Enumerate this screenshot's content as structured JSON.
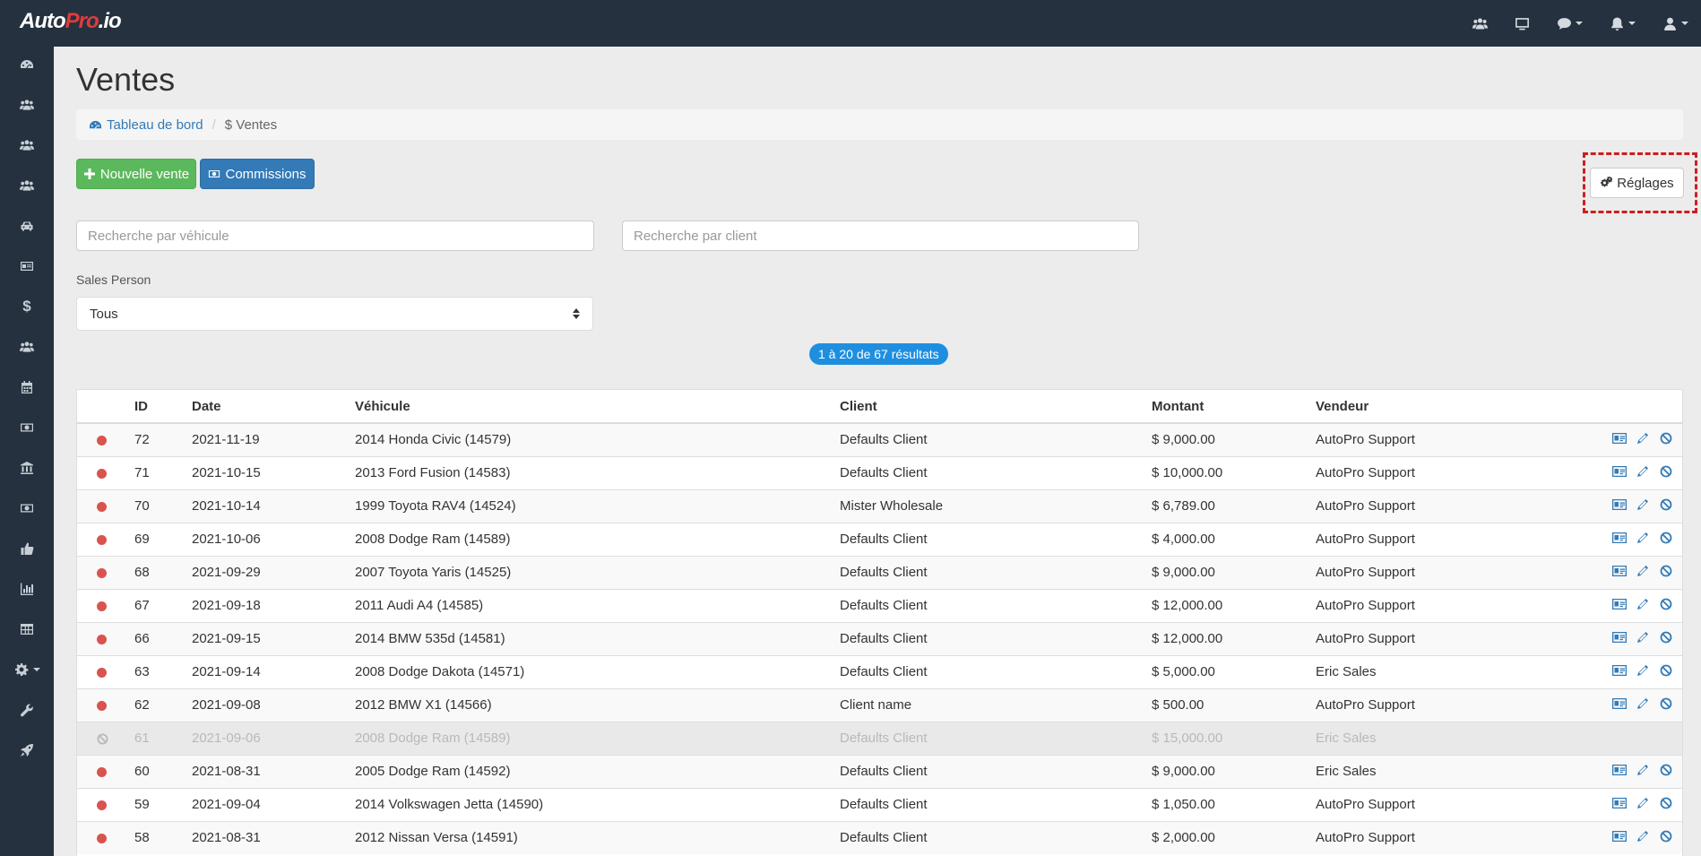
{
  "app": {
    "logo_main": "Auto",
    "logo_accent": "Pro",
    "logo_suffix": ".io"
  },
  "colors": {
    "navbar": "#26313f",
    "accent_red": "#e03b3b",
    "success": "#5cb85c",
    "primary": "#337ab7",
    "badge": "#1e8fe0",
    "status_dot": "#d9534f"
  },
  "topbar": {
    "icons": [
      "users-icon",
      "monitor-icon",
      "chat-icon",
      "bell-icon",
      "user-icon"
    ]
  },
  "sidebar": {
    "items": [
      "dashboard-icon",
      "users-icon",
      "users-icon",
      "users-icon",
      "car-icon",
      "id-card-icon",
      "dollar-icon",
      "users-icon",
      "calendar-icon",
      "money-icon",
      "bank-icon",
      "money-icon",
      "thumbs-up-icon",
      "bar-chart-icon",
      "table-icon",
      "gear-icon",
      "wrench-icon",
      "rocket-icon"
    ],
    "dollar_glyph": "$"
  },
  "page": {
    "title": "Ventes"
  },
  "breadcrumb": {
    "home": "Tableau de bord",
    "current_symbol": "$",
    "current": "Ventes"
  },
  "toolbar": {
    "new_sale": "Nouvelle vente",
    "commissions": "Commissions",
    "settings": "Réglages"
  },
  "filters": {
    "vehicle_placeholder": "Recherche par véhicule",
    "client_placeholder": "Recherche par client",
    "sales_person_label": "Sales Person",
    "sales_person_value": "Tous"
  },
  "results": {
    "badge": "1 à 20 de 67 résultats"
  },
  "table": {
    "headers": {
      "status": "",
      "id": "ID",
      "date": "Date",
      "vehicle": "Véhicule",
      "client": "Client",
      "amount": "Montant",
      "seller": "Vendeur",
      "actions": ""
    },
    "rows": [
      {
        "status": "active",
        "id": "72",
        "date": "2021-11-19",
        "vehicle": "2014 Honda Civic (14579)",
        "client": "Defaults Client",
        "amount": "$ 9,000.00",
        "seller": "AutoPro Support"
      },
      {
        "status": "active",
        "id": "71",
        "date": "2021-10-15",
        "vehicle": "2013 Ford Fusion (14583)",
        "client": "Defaults Client",
        "amount": "$ 10,000.00",
        "seller": "AutoPro Support"
      },
      {
        "status": "active",
        "id": "70",
        "date": "2021-10-14",
        "vehicle": "1999 Toyota RAV4 (14524)",
        "client": "Mister Wholesale",
        "amount": "$ 6,789.00",
        "seller": "AutoPro Support"
      },
      {
        "status": "active",
        "id": "69",
        "date": "2021-10-06",
        "vehicle": "2008 Dodge Ram (14589)",
        "client": "Defaults Client",
        "amount": "$ 4,000.00",
        "seller": "AutoPro Support"
      },
      {
        "status": "active",
        "id": "68",
        "date": "2021-09-29",
        "vehicle": "2007 Toyota Yaris (14525)",
        "client": "Defaults Client",
        "amount": "$ 9,000.00",
        "seller": "AutoPro Support"
      },
      {
        "status": "active",
        "id": "67",
        "date": "2021-09-18",
        "vehicle": "2011 Audi A4 (14585)",
        "client": "Defaults Client",
        "amount": "$ 12,000.00",
        "seller": "AutoPro Support"
      },
      {
        "status": "active",
        "id": "66",
        "date": "2021-09-15",
        "vehicle": "2014 BMW 535d (14581)",
        "client": "Defaults Client",
        "amount": "$ 12,000.00",
        "seller": "AutoPro Support"
      },
      {
        "status": "active",
        "id": "63",
        "date": "2021-09-14",
        "vehicle": "2008 Dodge Dakota (14571)",
        "client": "Defaults Client",
        "amount": "$ 5,000.00",
        "seller": "Eric Sales"
      },
      {
        "status": "active",
        "id": "62",
        "date": "2021-09-08",
        "vehicle": "2012 BMW X1 (14566)",
        "client": "Client name",
        "amount": "$ 500.00",
        "seller": "AutoPro Support"
      },
      {
        "status": "cancelled",
        "id": "61",
        "date": "2021-09-06",
        "vehicle": "2008 Dodge Ram (14589)",
        "client": "Defaults Client",
        "amount": "$ 15,000.00",
        "seller": "Eric Sales"
      },
      {
        "status": "active",
        "id": "60",
        "date": "2021-08-31",
        "vehicle": "2005 Dodge Ram (14592)",
        "client": "Defaults Client",
        "amount": "$ 9,000.00",
        "seller": "Eric Sales"
      },
      {
        "status": "active",
        "id": "59",
        "date": "2021-09-04",
        "vehicle": "2014 Volkswagen Jetta (14590)",
        "client": "Defaults Client",
        "amount": "$ 1,050.00",
        "seller": "AutoPro Support"
      },
      {
        "status": "active",
        "id": "58",
        "date": "2021-08-31",
        "vehicle": "2012 Nissan Versa (14591)",
        "client": "Defaults Client",
        "amount": "$ 2,000.00",
        "seller": "AutoPro Support"
      }
    ]
  }
}
